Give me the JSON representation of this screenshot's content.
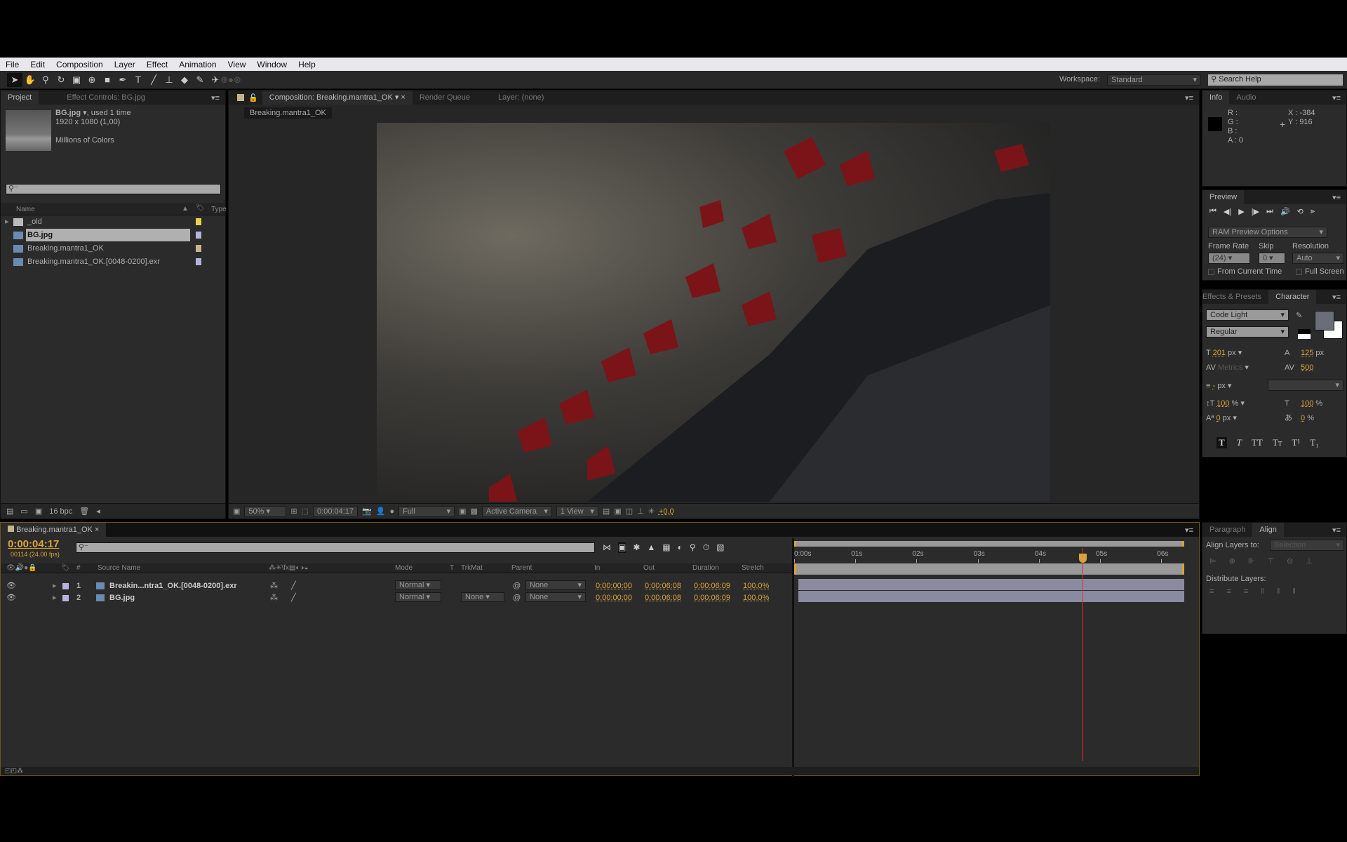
{
  "menu": [
    "File",
    "Edit",
    "Composition",
    "Layer",
    "Effect",
    "Animation",
    "View",
    "Window",
    "Help"
  ],
  "toolbar": {
    "workspace_label": "Workspace:",
    "workspace_value": "Standard",
    "search_placeholder": "Search Help"
  },
  "project": {
    "tabs": [
      "Project",
      "Effect Controls: BG.jpg"
    ],
    "selected_name": "BG.jpg",
    "selected_usage": ", used 1 time",
    "selected_dims": "1920 x 1080 (1,00)",
    "selected_colors": "Millions of Colors",
    "search_value": "",
    "col_name": "Name",
    "col_type": "Type",
    "items": [
      {
        "name": "_old",
        "icon": "folder-icon",
        "color": "#e8d24a"
      },
      {
        "name": "BG.jpg",
        "icon": "image-icon",
        "color": "#b4b4dc",
        "selected": true
      },
      {
        "name": "Breaking.mantra1_OK",
        "icon": "composition-icon",
        "color": "#c8b48c"
      },
      {
        "name": "Breaking.mantra1_OK.[0048-0200].exr",
        "icon": "footage-icon",
        "color": "#b4b4dc"
      }
    ],
    "bpc": "16 bpc"
  },
  "comp": {
    "tabs": [
      "Composition: Breaking.mantra1_OK",
      "Render Queue",
      "Layer: (none)"
    ],
    "breadcrumb": "Breaking.mantra1_OK",
    "zoom": "50%",
    "timecode": "0:00:04:17",
    "resolution": "Full",
    "camera": "Active Camera",
    "views": "1 View",
    "exposure": "+0,0"
  },
  "info": {
    "tabs": [
      "Info",
      "Audio"
    ],
    "r": "R :",
    "g": "G :",
    "b": "B :",
    "a": "A : 0",
    "x": "X : -384",
    "y": "Y : 916"
  },
  "preview": {
    "tab": "Preview",
    "ram_options": "RAM Preview Options",
    "frame_rate_label": "Frame Rate",
    "skip_label": "Skip",
    "resolution_label": "Resolution",
    "frame_rate": "(24)",
    "skip": "0",
    "resolution": "Auto",
    "from_current": "From Current Time",
    "full_screen": "Full Screen"
  },
  "character": {
    "tabs": [
      "Effects & Presets",
      "Character"
    ],
    "font": "Code Light",
    "style": "Regular",
    "size": "201",
    "size_unit": "px",
    "leading": "125",
    "leading_unit": "px",
    "kerning": "Metrics",
    "tracking": "500",
    "stroke": "-",
    "stroke_unit": "px",
    "vscale": "100",
    "hscale": "100",
    "pct": "%",
    "baseline": "0",
    "baseline_unit": "px",
    "tsume": "0",
    "fill_color": "#6a6e78",
    "styles": [
      "T",
      "T",
      "TT",
      "Tт",
      "T¹",
      "T₁"
    ]
  },
  "align": {
    "tabs": [
      "Paragraph",
      "Align"
    ],
    "align_to_label": "Align Layers to:",
    "align_to_value": "Selection",
    "distribute_label": "Distribute Layers:"
  },
  "timeline": {
    "tab": "Breaking.mantra1_OK",
    "timecode": "0:00:04:17",
    "frames": "00114 (24.00 fps)",
    "columns": {
      "num": "#",
      "source": "Source Name",
      "mode": "Mode",
      "t": "T",
      "trkmat": "TrkMat",
      "parent": "Parent",
      "in": "In",
      "out": "Out",
      "duration": "Duration",
      "stretch": "Stretch"
    },
    "ruler": [
      "0:00s",
      "01s",
      "02s",
      "03s",
      "04s",
      "05s",
      "06s"
    ],
    "current_time_s": 4.708,
    "duration_s": 6.375,
    "layers": [
      {
        "num": "1",
        "name": "Breakin...ntra1_OK.[0048-0200].exr",
        "mode": "Normal",
        "trkmat": "",
        "parent": "None",
        "in": "0:00:00:00",
        "out": "0:00:06:08",
        "duration": "0:00:06:09",
        "stretch": "100,0%",
        "icon": "footage-icon"
      },
      {
        "num": "2",
        "name": "BG.jpg",
        "mode": "Normal",
        "trkmat": "None",
        "parent": "None",
        "in": "0:00:00:00",
        "out": "0:00:06:08",
        "duration": "0:00:06:09",
        "stretch": "100,0%",
        "icon": "image-icon"
      }
    ]
  },
  "colors": {
    "accent": "#d9a33a",
    "playhead": "#e03030",
    "layer_bar": "#8a8aa0"
  }
}
